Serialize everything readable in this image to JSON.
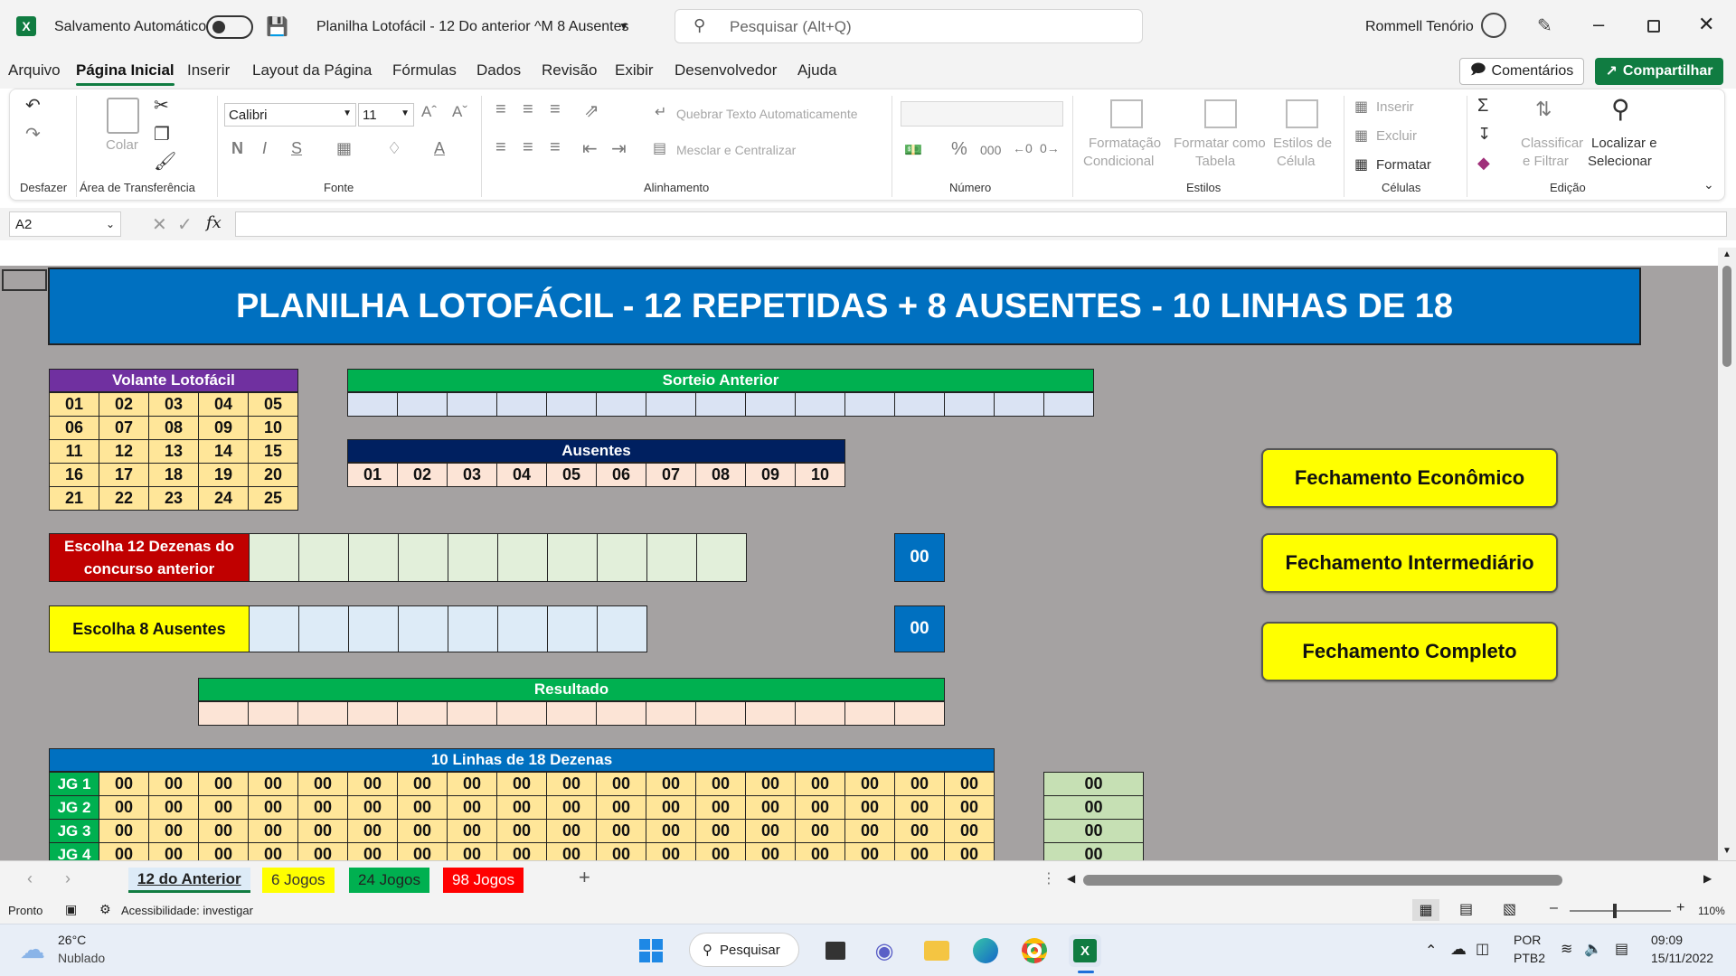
{
  "titlebar": {
    "autosave_label": "Salvamento Automático",
    "doc_title": "Planilha Lotofácil - 12 Do anterior ^M 8 Ausentes",
    "search_placeholder": "Pesquisar (Alt+Q)",
    "user_name": "Rommell Tenório"
  },
  "menu": [
    "Arquivo",
    "Página Inicial",
    "Inserir",
    "Layout da Página",
    "Fórmulas",
    "Dados",
    "Revisão",
    "Exibir",
    "Desenvolvedor",
    "Ajuda"
  ],
  "menu_active": "Página Inicial",
  "actions": {
    "comments": "Comentários",
    "share": "Compartilhar"
  },
  "ribbon": {
    "undo_group": "Desfazer",
    "clipboard_group": "Área de Transferência",
    "paste": "Colar",
    "font_group": "Fonte",
    "font_name": "Calibri",
    "font_size": "11",
    "align_group": "Alinhamento",
    "wrap_text": "Quebrar Texto Automaticamente",
    "merge_center": "Mesclar e Centralizar",
    "number_group": "Número",
    "styles_group": "Estilos",
    "cond_format_1": "Formatação",
    "cond_format_2": "Condicional",
    "format_table_1": "Formatar como",
    "format_table_2": "Tabela",
    "cell_styles_1": "Estilos de",
    "cell_styles_2": "Célula",
    "cells_group": "Células",
    "insert": "Inserir",
    "delete": "Excluir",
    "format": "Formatar",
    "edit_group": "Edição",
    "sort_filter_1": "Classificar",
    "sort_filter_2": "e Filtrar",
    "find_select_1": "Localizar e",
    "find_select_2": "Selecionar"
  },
  "formula": {
    "name_box": "A2",
    "content": ""
  },
  "sheet": {
    "main_title": "PLANILHA LOTOFÁCIL - 12 REPETIDAS + 8 AUSENTES - 10 LINHAS DE 18",
    "volante_title": "Volante Lotofácil",
    "volante": [
      [
        "01",
        "02",
        "03",
        "04",
        "05"
      ],
      [
        "06",
        "07",
        "08",
        "09",
        "10"
      ],
      [
        "11",
        "12",
        "13",
        "14",
        "15"
      ],
      [
        "16",
        "17",
        "18",
        "19",
        "20"
      ],
      [
        "21",
        "22",
        "23",
        "24",
        "25"
      ]
    ],
    "sorteio_title": "Sorteio Anterior",
    "ausentes_title": "Ausentes",
    "ausentes": [
      "01",
      "02",
      "03",
      "04",
      "05",
      "06",
      "07",
      "08",
      "09",
      "10"
    ],
    "escolha12_line1": "Escolha 12 Dezenas do",
    "escolha12_line2": "concurso anterior",
    "escolha12_count": "00",
    "escolha8": "Escolha 8 Ausentes",
    "escolha8_count": "00",
    "resultado_title": "Resultado",
    "linhas_title": "10 Linhas de 18 Dezenas",
    "rows": [
      "JG 1",
      "JG 2",
      "JG 3",
      "JG 4"
    ],
    "zero": "00",
    "btn_economico": "Fechamento Econômico",
    "btn_intermediario": "Fechamento Intermediário",
    "btn_completo": "Fechamento Completo"
  },
  "tabs": [
    {
      "label": "12 do Anterior",
      "color": "#e6e6e6"
    },
    {
      "label": "6 Jogos",
      "color": "#ffff00"
    },
    {
      "label": "24 Jogos",
      "color": "#00b050"
    },
    {
      "label": "98 Jogos",
      "color": "#ff0000"
    }
  ],
  "status": {
    "ready": "Pronto",
    "accessibility": "Acessibilidade: investigar",
    "zoom": "110%"
  },
  "taskbar": {
    "temp": "26°C",
    "weather": "Nublado",
    "search": "Pesquisar",
    "lang1": "POR",
    "lang2": "PTB2",
    "time": "09:09",
    "date": "15/11/2022"
  },
  "colors": {
    "excel_green": "#107c41",
    "title_blue": "#0070c0",
    "purple": "#7030a0",
    "green": "#00b050",
    "navy": "#002060",
    "red": "#c00000"
  }
}
